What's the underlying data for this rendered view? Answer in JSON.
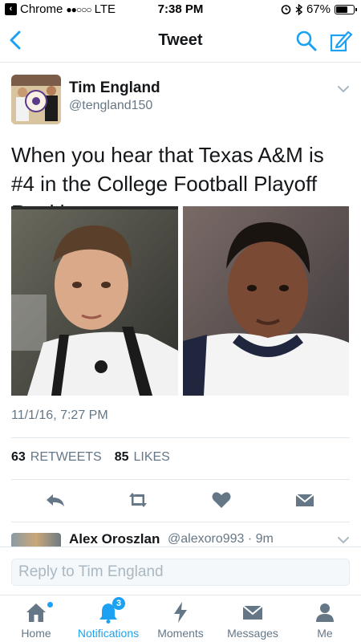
{
  "status_bar": {
    "carrier": "Chrome",
    "signal": "●●○○○",
    "network": "LTE",
    "time": "7:38 PM",
    "battery_text": "67%",
    "battery_level": 0.67
  },
  "nav": {
    "title": "Tweet",
    "back_icon": "chevron-left-icon",
    "search_icon": "search-icon",
    "compose_icon": "compose-icon"
  },
  "tweet": {
    "author_name": "Tim England",
    "author_handle": "@tengland150",
    "text": "When you hear that Texas A&M is #4 in the College Football Playoff Rankings",
    "timestamp": "11/1/16, 7:27 PM",
    "retweets_count": "63",
    "retweets_label": "RETWEETS",
    "likes_count": "85",
    "likes_label": "LIKES"
  },
  "actions": [
    "reply-icon",
    "retweet-icon",
    "like-icon",
    "direct-message-icon"
  ],
  "reply": {
    "author_name": "Alex Oroszlan",
    "author_handle": "@alexoro993 · 9m"
  },
  "reply_bar": {
    "placeholder": "Reply to Tim England"
  },
  "tabs": [
    {
      "label": "Home",
      "icon": "home-icon",
      "active": false
    },
    {
      "label": "Notifications",
      "icon": "bell-icon",
      "active": true,
      "badge": "3"
    },
    {
      "label": "Moments",
      "icon": "lightning-icon",
      "active": false
    },
    {
      "label": "Messages",
      "icon": "envelope-icon",
      "active": false
    },
    {
      "label": "Me",
      "icon": "person-icon",
      "active": false
    }
  ],
  "colors": {
    "accent": "#1da1f2",
    "secondary_text": "#657786",
    "divider": "#e1e8ed"
  }
}
